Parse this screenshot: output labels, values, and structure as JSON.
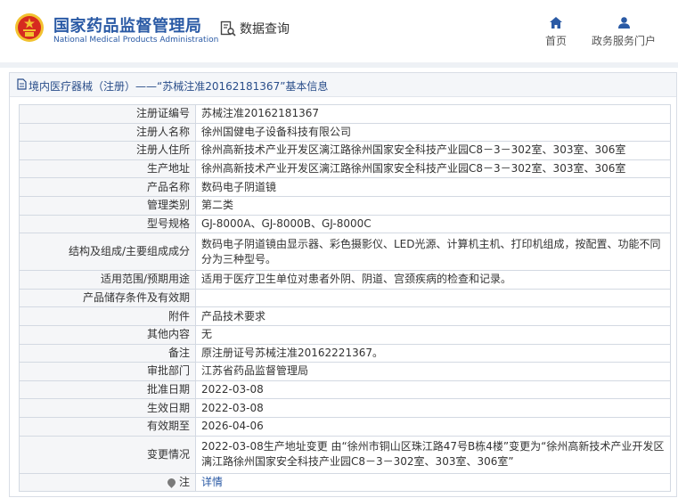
{
  "header": {
    "title_cn": "国家药品监督管理局",
    "title_en": "National Medical Products Administration",
    "query_label": "数据查询",
    "nav": [
      {
        "label": "首页",
        "icon": "home-icon"
      },
      {
        "label": "政务服务门户",
        "icon": "user-icon"
      }
    ]
  },
  "breadcrumb": "境内医疗器械（注册）——“苏械注准20162181367”基本信息",
  "rows": [
    {
      "key": "注册证编号",
      "value": "苏械注准20162181367"
    },
    {
      "key": "注册人名称",
      "value": "徐州国健电子设备科技有限公司"
    },
    {
      "key": "注册人住所",
      "value": "徐州高新技术产业开发区漓江路徐州国家安全科技产业园C8－3－302室、303室、306室"
    },
    {
      "key": "生产地址",
      "value": "徐州高新技术产业开发区漓江路徐州国家安全科技产业园C8－3－302室、303室、306室"
    },
    {
      "key": "产品名称",
      "value": "数码电子阴道镜"
    },
    {
      "key": "管理类别",
      "value": "第二类"
    },
    {
      "key": "型号规格",
      "value": "GJ-8000A、GJ-8000B、GJ-8000C"
    },
    {
      "key": "结构及组成/主要组成成分",
      "value": "数码电子阴道镜由显示器、彩色摄影仪、LED光源、计算机主机、打印机组成，按配置、功能不同分为三种型号。"
    },
    {
      "key": "适用范围/预期用途",
      "value": "适用于医疗卫生单位对患者外阴、阴道、宫颈疾病的检查和记录。"
    },
    {
      "key": "产品储存条件及有效期",
      "value": ""
    },
    {
      "key": "附件",
      "value": "产品技术要求"
    },
    {
      "key": "其他内容",
      "value": "无"
    },
    {
      "key": "备注",
      "value": "原注册证号苏械注准20162221367。"
    },
    {
      "key": "审批部门",
      "value": "江苏省药品监督管理局"
    },
    {
      "key": "批准日期",
      "value": "2022-03-08"
    },
    {
      "key": "生效日期",
      "value": "2022-03-08"
    },
    {
      "key": "有效期至",
      "value": "2026-04-06"
    },
    {
      "key": "变更情况",
      "value": "2022-03-08生产地址变更 由“徐州市铜山区珠江路47号B栋4楼”变更为“徐州高新技术产业开发区漓江路徐州国家安全科技产业园C8－3－302室、303室、306室”"
    }
  ],
  "note": {
    "key": "注",
    "value": "详情"
  },
  "colors": {
    "brand_blue": "#2a5aa5",
    "emblem_red": "#d62a1f",
    "emblem_gold": "#f2c230"
  }
}
